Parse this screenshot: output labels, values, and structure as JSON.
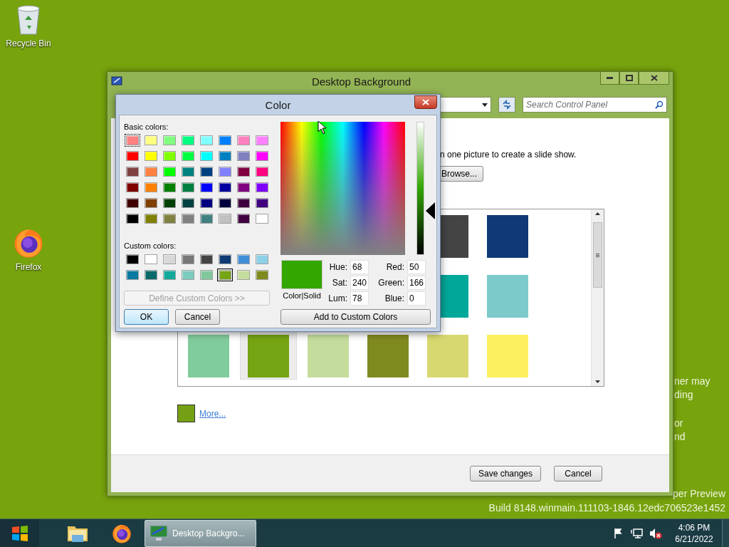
{
  "desktop": {
    "icons": [
      {
        "kind": "recycle",
        "label": "Recycle Bin"
      },
      {
        "kind": "firefox",
        "label": "Firefox"
      }
    ],
    "notes": [
      {
        "lines": [
          "ner may",
          "ding"
        ]
      },
      {
        "lines": [
          "or",
          "nd"
        ]
      }
    ],
    "edition": "per Preview",
    "build": "Build 8148.winmain.111103-1846.12edc706523e1452"
  },
  "main_window": {
    "title": "Desktop Background",
    "search": {
      "placeholder": "Search Control Panel"
    },
    "intro_text": "n one picture to create a slide show.",
    "browse_button": "Browse...",
    "picture_rows": [
      {
        "tiles": [
          {
            "color": "#444444",
            "selected": false
          },
          {
            "color": "#0f3a75",
            "selected": false
          }
        ]
      },
      {
        "tiles": [
          {
            "color": "#00a89a",
            "selected": false
          },
          {
            "color": "#7ccaca",
            "selected": false
          }
        ]
      },
      {
        "tiles": [
          {
            "color": "#80cc9c",
            "selected": false
          },
          {
            "color": "#75a414",
            "selected": true
          },
          {
            "color": "#c4dd9c",
            "selected": false
          },
          {
            "color": "#7f8a1f",
            "selected": false
          },
          {
            "color": "#d8d870",
            "selected": false
          },
          {
            "color": "#fcf060",
            "selected": false
          }
        ]
      }
    ],
    "current_color": {
      "color": "#75a014"
    },
    "more_link": "More...",
    "buttons": [
      "Save changes",
      "Cancel"
    ]
  },
  "color_dialog": {
    "title": "Color",
    "basic_label": "Basic colors:",
    "basic_colors": [
      {
        "color": "#ff8080",
        "selected": true
      },
      {
        "color": "#ffff80",
        "selected": false
      },
      {
        "color": "#80ff80",
        "selected": false
      },
      {
        "color": "#00ff80",
        "selected": false
      },
      {
        "color": "#80ffff",
        "selected": false
      },
      {
        "color": "#0080ff",
        "selected": false
      },
      {
        "color": "#ff80c0",
        "selected": false
      },
      {
        "color": "#ff80ff",
        "selected": false
      },
      {
        "color": "#ff0000",
        "selected": false
      },
      {
        "color": "#ffff00",
        "selected": false
      },
      {
        "color": "#80ff00",
        "selected": false
      },
      {
        "color": "#00ff40",
        "selected": false
      },
      {
        "color": "#00ffff",
        "selected": false
      },
      {
        "color": "#0080c0",
        "selected": false
      },
      {
        "color": "#8080c0",
        "selected": false
      },
      {
        "color": "#ff00ff",
        "selected": false
      },
      {
        "color": "#804040",
        "selected": false
      },
      {
        "color": "#ff8040",
        "selected": false
      },
      {
        "color": "#00ff00",
        "selected": false
      },
      {
        "color": "#008080",
        "selected": false
      },
      {
        "color": "#004080",
        "selected": false
      },
      {
        "color": "#8080ff",
        "selected": false
      },
      {
        "color": "#800040",
        "selected": false
      },
      {
        "color": "#ff0080",
        "selected": false
      },
      {
        "color": "#800000",
        "selected": false
      },
      {
        "color": "#ff8000",
        "selected": false
      },
      {
        "color": "#008000",
        "selected": false
      },
      {
        "color": "#008040",
        "selected": false
      },
      {
        "color": "#0000ff",
        "selected": false
      },
      {
        "color": "#0000a0",
        "selected": false
      },
      {
        "color": "#800080",
        "selected": false
      },
      {
        "color": "#8000ff",
        "selected": false
      },
      {
        "color": "#400000",
        "selected": false
      },
      {
        "color": "#804000",
        "selected": false
      },
      {
        "color": "#004000",
        "selected": false
      },
      {
        "color": "#004040",
        "selected": false
      },
      {
        "color": "#000080",
        "selected": false
      },
      {
        "color": "#000040",
        "selected": false
      },
      {
        "color": "#400040",
        "selected": false
      },
      {
        "color": "#400080",
        "selected": false
      },
      {
        "color": "#000000",
        "selected": false
      },
      {
        "color": "#808000",
        "selected": false
      },
      {
        "color": "#808040",
        "selected": false
      },
      {
        "color": "#808080",
        "selected": false
      },
      {
        "color": "#408080",
        "selected": false
      },
      {
        "color": "#c0c0c0",
        "selected": false
      },
      {
        "color": "#400040",
        "selected": false
      },
      {
        "color": "#ffffff",
        "selected": false
      }
    ],
    "custom_label": "Custom colors:",
    "custom_colors": [
      {
        "color": "#000000",
        "selected": false
      },
      {
        "color": "#ffffff",
        "selected": false
      },
      {
        "color": "#d8d8d8",
        "selected": false
      },
      {
        "color": "#777777",
        "selected": false
      },
      {
        "color": "#444444",
        "selected": false
      },
      {
        "color": "#0f3a75",
        "selected": false
      },
      {
        "color": "#3f8fd8",
        "selected": false
      },
      {
        "color": "#8dd0e8",
        "selected": false
      },
      {
        "color": "#0b7aa0",
        "selected": false
      },
      {
        "color": "#0b6b6b",
        "selected": false
      },
      {
        "color": "#12a89a",
        "selected": false
      },
      {
        "color": "#7ccbbe",
        "selected": false
      },
      {
        "color": "#80c89c",
        "selected": false
      },
      {
        "color": "#75a414",
        "selected": true
      },
      {
        "color": "#c4dd9c",
        "selected": false
      },
      {
        "color": "#7f8a1f",
        "selected": false
      }
    ],
    "define_button": {
      "label": "Define Custom Colors >>",
      "disabled": true
    },
    "ok_button": "OK",
    "cancel_button": "Cancel",
    "luminance": {
      "level": 0.33
    },
    "preview": {
      "color": "#33a600",
      "label": "Color|Solid"
    },
    "hsl_fields": [
      {
        "label": "Hue:",
        "value": "68"
      },
      {
        "label": "Sat:",
        "value": "240"
      },
      {
        "label": "Lum:",
        "value": "78"
      }
    ],
    "rgb_fields": [
      {
        "label": "Red:",
        "value": "50"
      },
      {
        "label": "Green:",
        "value": "166"
      },
      {
        "label": "Blue:",
        "value": "0"
      }
    ],
    "add_button": "Add to Custom Colors"
  },
  "taskbar": {
    "pinned": [
      {
        "kind": "explorer"
      },
      {
        "kind": "firefox"
      }
    ],
    "tasks": [
      {
        "label": "Desktop Backgro...",
        "selected": true
      }
    ],
    "tray": [
      {
        "kind": "flag"
      },
      {
        "kind": "network"
      },
      {
        "kind": "volume-muted"
      }
    ],
    "clock": {
      "time": "4:06 PM",
      "date": "6/21/2022"
    }
  }
}
